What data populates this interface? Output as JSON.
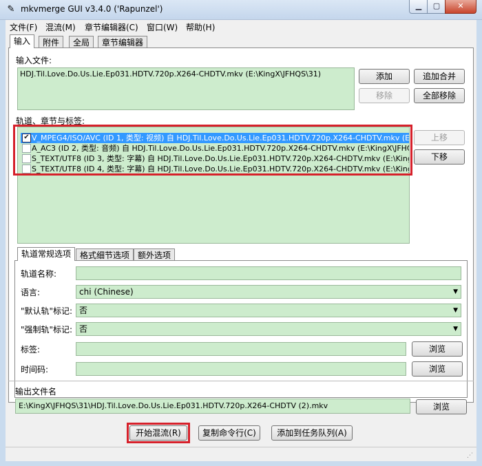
{
  "window": {
    "title": "mkvmerge GUI v3.4.0 ('Rapunzel')"
  },
  "menu": [
    "文件(F)",
    "混流(M)",
    "章节编辑器(C)",
    "窗口(W)",
    "帮助(H)"
  ],
  "tabs": [
    "输入",
    "附件",
    "全局",
    "章节编辑器"
  ],
  "input": {
    "files_label": "输入文件:",
    "files": [
      "HDJ.Til.Love.Do.Us.Lie.Ep031.HDTV.720p.X264-CHDTV.mkv (E:\\KingX\\JFHQS\\31)"
    ],
    "add": "添加",
    "append": "追加合并",
    "remove": "移除",
    "remove_all": "全部移除"
  },
  "tracks": {
    "label": "轨道、章节与标签:",
    "items": [
      "V_MPEG4/ISO/AVC (ID 1, 类型: 视频) 自 HDJ.Til.Love.Do.Us.Lie.Ep031.HDTV.720p.X264-CHDTV.mkv (E:\\KingX\\J",
      "A_AC3 (ID 2, 类型: 音频) 自 HDJ.Til.Love.Do.Us.Lie.Ep031.HDTV.720p.X264-CHDTV.mkv (E:\\KingX\\JFHQS\\31)",
      "S_TEXT/UTF8 (ID 3, 类型: 字幕) 自 HDJ.Til.Love.Do.Us.Lie.Ep031.HDTV.720p.X264-CHDTV.mkv (E:\\KingX\\JFHQS",
      "S_TEXT/UTF8 (ID 4, 类型: 字幕) 自 HDJ.Til.Love.Do.Us.Lie.Ep031.HDTV.720p.X264-CHDTV.mkv (E:\\KingX\\JFHQS"
    ],
    "checked": [
      true,
      false,
      false,
      false
    ],
    "move_up": "上移",
    "move_down": "下移"
  },
  "track_options": {
    "tabs": [
      "轨道常规选项",
      "格式细节选项",
      "额外选项"
    ],
    "name_label": "轨道名称:",
    "language_label": "语言:",
    "language_value": "chi (Chinese)",
    "default_label": "\"默认轨\"标记:",
    "default_value": "否",
    "forced_label": "\"强制轨\"标记:",
    "forced_value": "否",
    "tags_label": "标签:",
    "timecodes_label": "时间码:",
    "browse": "浏览"
  },
  "output": {
    "label": "输出文件名",
    "value": "E:\\KingX\\JFHQS\\31\\HDJ.Til.Love.Do.Us.Lie.Ep031.HDTV.720p.X264-CHDTV (2).mkv",
    "browse": "浏览"
  },
  "actions": {
    "start": "开始混流(R)",
    "copy": "复制命令行(C)",
    "queue": "添加到任务队列(A)"
  },
  "icons": {
    "app": "mkvmerge-app-icon",
    "minimize": "minimize-icon",
    "maximize": "maximize-icon",
    "close": "close-icon",
    "dropdown": "chevron-down-icon",
    "checkbox": "checkmark-icon",
    "grip": "resize-grip-icon"
  },
  "colors": {
    "field_bg": "#cdeccd",
    "selection": "#3399ff",
    "highlight_box": "#d6202a"
  }
}
